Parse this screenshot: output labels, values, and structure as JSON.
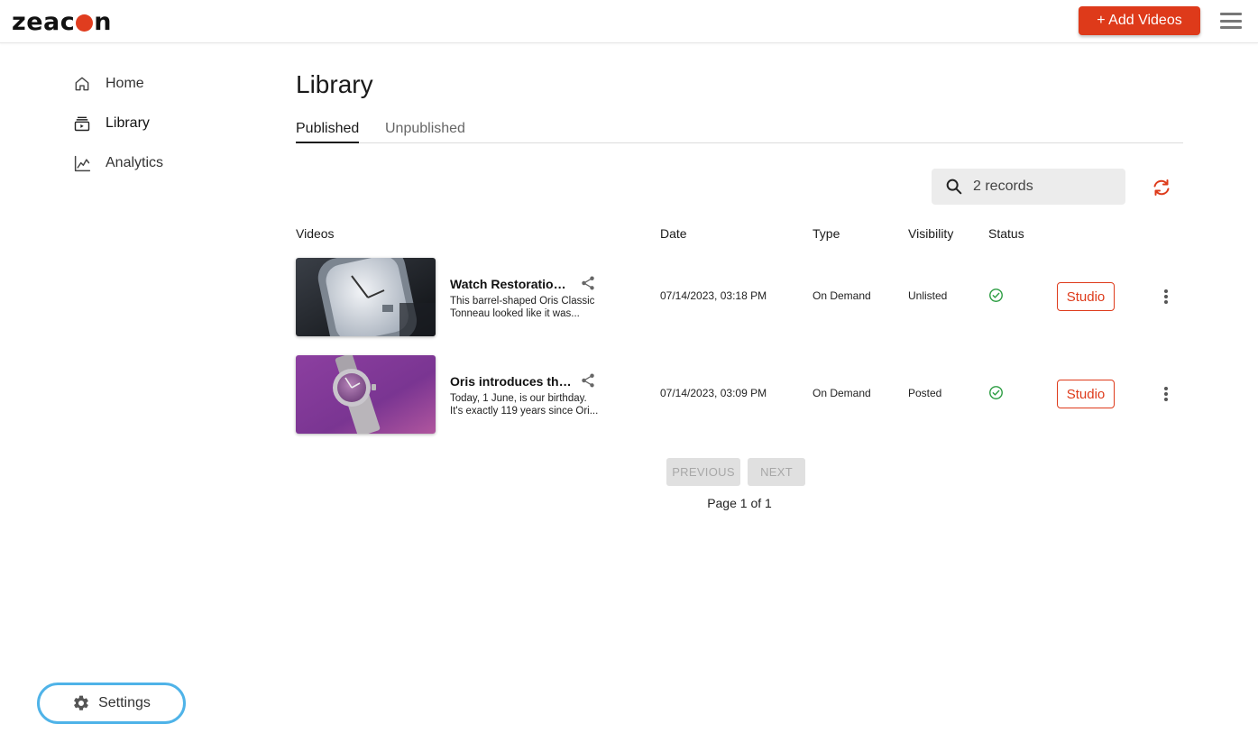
{
  "app": {
    "logo": "zeacon"
  },
  "header": {
    "add_videos_label": "+ Add Videos"
  },
  "sidebar": {
    "items": [
      {
        "label": "Home",
        "icon": "home-icon",
        "active": false
      },
      {
        "label": "Library",
        "icon": "library-icon",
        "active": true
      },
      {
        "label": "Analytics",
        "icon": "analytics-icon",
        "active": false
      }
    ],
    "settings_label": "Settings"
  },
  "main": {
    "title": "Library",
    "tabs": [
      {
        "label": "Published",
        "active": true
      },
      {
        "label": "Unpublished",
        "active": false
      }
    ],
    "search": {
      "placeholder": "2 records"
    },
    "columns": [
      "Videos",
      "Date",
      "Type",
      "Visibility",
      "Status"
    ],
    "rows": [
      {
        "title": "Watch Restoration | ...",
        "desc_line1": "This barrel-shaped Oris Classic",
        "desc_line2": "Tonneau looked like it was...",
        "date": "07/14/2023, 03:18 PM",
        "type": "On Demand",
        "visibility": "Unlisted",
        "status": "check-circle-icon",
        "action_label": "Studio"
      },
      {
        "title": "Oris introduces the H...",
        "desc_line1": "Today, 1 June, is our birthday.",
        "desc_line2": "It's exactly 119 years since Ori...",
        "date": "07/14/2023, 03:09 PM",
        "type": "On Demand",
        "visibility": "Posted",
        "status": "check-circle-icon",
        "action_label": "Studio"
      }
    ],
    "pagination": {
      "previous_label": "PREVIOUS",
      "next_label": "NEXT",
      "page_info": "Page 1 of 1"
    }
  },
  "colors": {
    "accent": "#de3a1a",
    "success": "#2e9e44",
    "focus_ring": "#4fb3e8"
  }
}
